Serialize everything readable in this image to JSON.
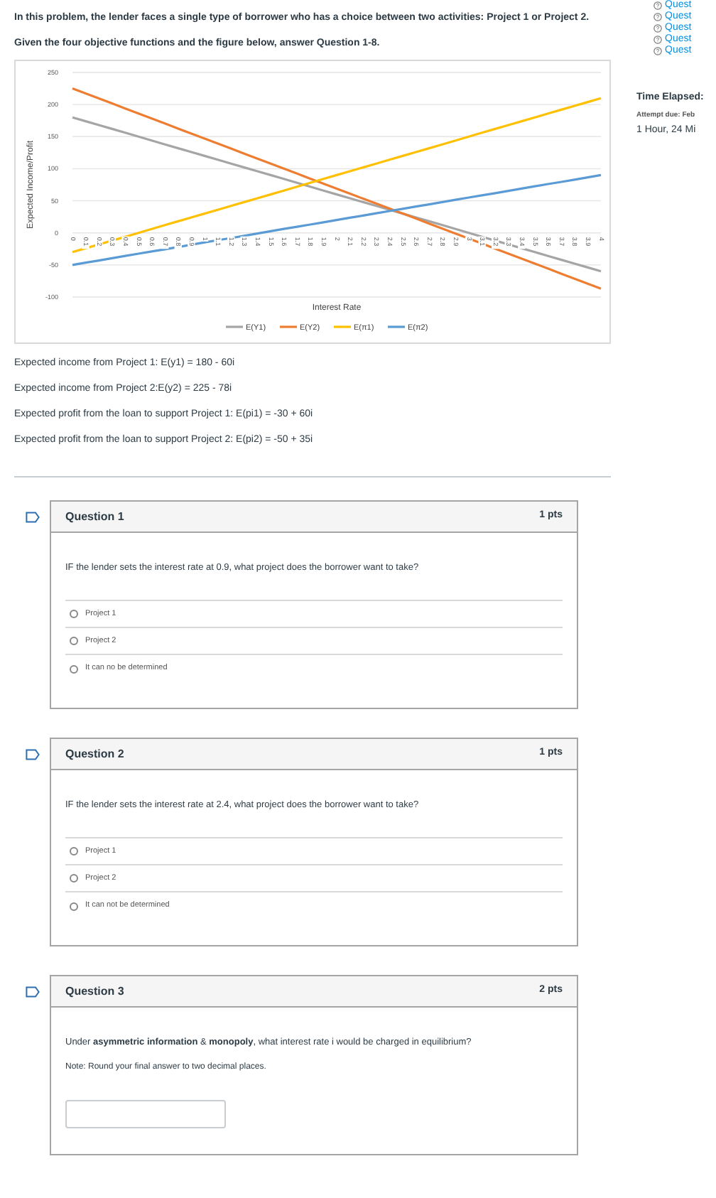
{
  "intro": [
    "In this problem, the lender faces a single type of borrower who has a choice between two activities: Project 1 or Project 2.",
    "Given the four objective functions and the figure below, answer Question 1-8."
  ],
  "chart": {
    "chart_data": {
      "type": "line",
      "xlabel": "Interest Rate",
      "ylabel": "Expected Income/Profit",
      "categories": [
        "0",
        "0.1",
        "0.2",
        "0.3",
        "0.4",
        "0.5",
        "0.6",
        "0.7",
        "0.8",
        "0.9",
        "1",
        "1.1",
        "1.2",
        "1.3",
        "1.4",
        "1.5",
        "1.6",
        "1.7",
        "1.8",
        "1.9",
        "2",
        "2.1",
        "2.2",
        "2.3",
        "2.4",
        "2.5",
        "2.6",
        "2.7",
        "2.8",
        "2.9",
        "3",
        "3.1",
        "3.2",
        "3.3",
        "3.4",
        "3.5",
        "3.6",
        "3.7",
        "3.8",
        "3.9",
        "4"
      ],
      "ylim": [
        -100,
        250
      ],
      "grid": true,
      "legend": true,
      "yticks": [
        -100,
        -50,
        0,
        50,
        100,
        150,
        200,
        250
      ],
      "series": [
        {
          "name": "E(Y1)",
          "color": "#a5a5a5",
          "values": [
            180,
            174,
            168,
            162,
            156,
            150,
            144,
            138,
            132,
            126,
            120,
            114,
            108,
            102,
            96,
            90,
            84,
            78,
            72,
            66,
            60,
            54,
            48,
            42,
            36,
            30,
            24,
            18,
            12,
            6,
            0,
            -6,
            -12,
            -18,
            -24,
            -30,
            -36,
            -42,
            -48,
            -54,
            -60
          ]
        },
        {
          "name": "E(Y2)",
          "color": "#ed7d31",
          "values": [
            225,
            217.2,
            209.4,
            201.6,
            193.8,
            186,
            178.2,
            170.4,
            162.6,
            154.8,
            147,
            139.2,
            131.4,
            123.6,
            115.8,
            108,
            100.2,
            92.4,
            84.6,
            76.8,
            69,
            61.2,
            53.4,
            45.6,
            37.8,
            30,
            22.2,
            14.4,
            6.6,
            -1.2,
            -9,
            -16.8,
            -24.6,
            -32.4,
            -40.2,
            -48,
            -55.8,
            -63.6,
            -71.4,
            -79.2,
            -87
          ]
        },
        {
          "name": "E(π1)",
          "color": "#ffc000",
          "values": [
            -30,
            -24,
            -18,
            -12,
            -6,
            0,
            6,
            12,
            18,
            24,
            30,
            36,
            42,
            48,
            54,
            60,
            66,
            72,
            78,
            84,
            90,
            96,
            102,
            108,
            114,
            120,
            126,
            132,
            138,
            144,
            150,
            156,
            162,
            168,
            174,
            180,
            186,
            192,
            198,
            204,
            210
          ]
        },
        {
          "name": "E(π2)",
          "color": "#5b9bd5",
          "values": [
            -50,
            -46.5,
            -43,
            -39.5,
            -36,
            -32.5,
            -29,
            -25.5,
            -22,
            -18.5,
            -15,
            -11.5,
            -8,
            -4.5,
            -1,
            2.5,
            6,
            9.5,
            13,
            16.5,
            20,
            23.5,
            27,
            30.5,
            34,
            37.5,
            41,
            44.5,
            48,
            51.5,
            55,
            58.5,
            62,
            65.5,
            69,
            72.5,
            76,
            79.5,
            83,
            86.5,
            90
          ]
        }
      ]
    }
  },
  "formulas": [
    "Expected income from Project 1: E(y1) = 180 - 60i",
    "Expected income from Project 2:E(y2) = 225 - 78i",
    "Expected profit from the loan to support Project 1: E(pi1) = -30 + 60i",
    "Expected profit from the loan to support Project 2: E(pi2) = -50 + 35i"
  ],
  "questions": [
    {
      "kind": "choice",
      "title": "Question 1",
      "points": "1 pts",
      "prompt": "IF the lender sets the interest rate at 0.9, what project does the borrower want to take?",
      "answers": [
        {
          "label": "Project 1",
          "selected": false
        },
        {
          "label": "Project 2",
          "selected": false
        },
        {
          "label": "It can no be determined",
          "selected": false
        }
      ]
    },
    {
      "kind": "choice",
      "title": "Question 2",
      "points": "1 pts",
      "prompt": "IF the lender sets the interest rate at 2.4, what project does the borrower want to take?",
      "answers": [
        {
          "label": "Project 1",
          "selected": false
        },
        {
          "label": "Project 2",
          "selected": false
        },
        {
          "label": "It can not be determined",
          "selected": false
        }
      ]
    },
    {
      "kind": "numeric",
      "title": "Question 3",
      "points": "2 pts",
      "prompt": "Under **asymmetric information** & **monopoly**, what interest rate i would be charged in equilibrium?",
      "note": "Note: Round your final answer to two decimal places."
    }
  ],
  "sidebar": {
    "question_links": [
      "Quest",
      "Quest",
      "Quest",
      "Quest",
      "Quest"
    ],
    "time_label": "Time Elapsed:",
    "attempt_due": "Attempt due: Feb",
    "time_value": "1 Hour, 24 Mi"
  }
}
